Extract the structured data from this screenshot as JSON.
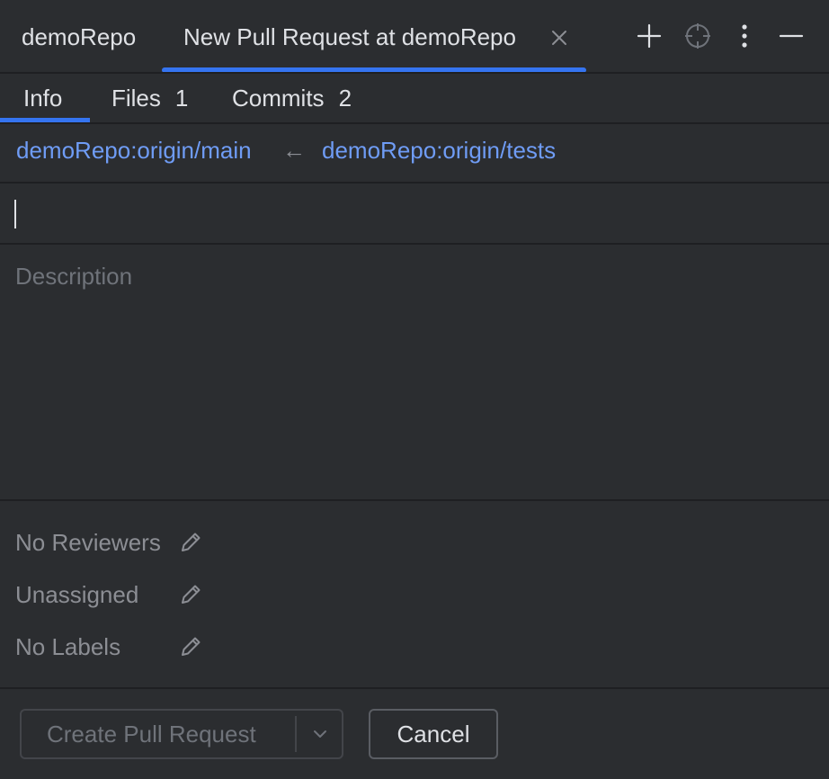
{
  "window": {
    "project_tab": "demoRepo",
    "active_tab": "New Pull Request at demoRepo",
    "icons": [
      "plus-icon",
      "target-icon",
      "more-vertical-icon",
      "minimize-icon"
    ]
  },
  "subtabs": {
    "info": {
      "label": "Info"
    },
    "files": {
      "label": "Files",
      "count": "1"
    },
    "commits": {
      "label": "Commits",
      "count": "2"
    }
  },
  "branches": {
    "target": "demoRepo:origin/main",
    "arrow": "←",
    "source": "demoRepo:origin/tests"
  },
  "form": {
    "title_value": "",
    "description_placeholder": "Description"
  },
  "metadata": {
    "reviewers": "No Reviewers",
    "assignee": "Unassigned",
    "labels": "No Labels"
  },
  "actions": {
    "create_label": "Create Pull Request",
    "cancel_label": "Cancel"
  },
  "colors": {
    "background": "#2b2d30",
    "accent": "#3574f0",
    "link": "#6f9cf5",
    "muted_text": "#8c8e94"
  }
}
